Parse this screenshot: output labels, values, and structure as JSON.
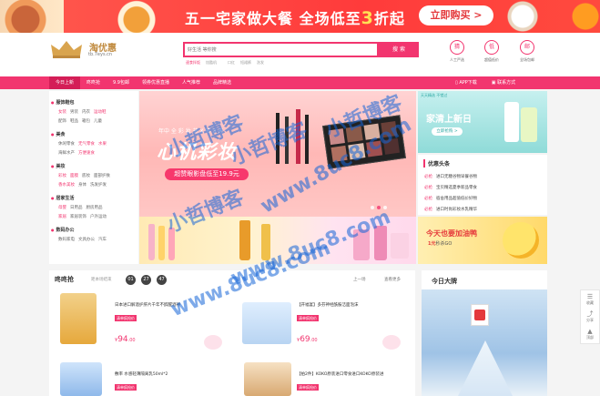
{
  "top_banner": {
    "text_before": "五一宅家做大餐  全场低至",
    "highlight": "3",
    "text_after": "折起",
    "button": "立即购买 >"
  },
  "logo": {
    "title": "淘优惠",
    "domain": "tb.7eys.cn"
  },
  "search": {
    "placeholder": "好生活 等你搜",
    "button": "搜 索",
    "hotwords": [
      "速食拌饭",
      "炫酷机",
      "",
      "口红",
      "短裙裤",
      "洗发"
    ]
  },
  "header_icons": [
    {
      "glyph": "猜",
      "label": "人工严选"
    },
    {
      "glyph": "低",
      "label": "超值低价"
    },
    {
      "glyph": "邮",
      "label": "全场包邮"
    }
  ],
  "nav": {
    "items": [
      "今日上新",
      "咚咚抢",
      "9.9包邮",
      "领券优惠直播",
      "人气推荐",
      "品牌精选"
    ],
    "active_index": 0,
    "right": [
      "APP下载",
      "联系方式"
    ]
  },
  "categories": [
    {
      "title": "服饰鞋包",
      "rows": [
        [
          "女装",
          "男装",
          "内衣",
          "运动鞋"
        ],
        [
          "配饰",
          "鞋品",
          "箱包",
          "儿童"
        ]
      ]
    },
    {
      "title": "美食",
      "rows": [
        [
          "休闲零食",
          "无气零食",
          "水果"
        ],
        [
          "海鲜水产",
          "方便速食"
        ]
      ]
    },
    {
      "title": "美妆",
      "rows": [
        [
          "彩妆",
          "面膜",
          "底妆",
          "面部护肤"
        ],
        [
          "香水美妆",
          "身体",
          "洗发护发"
        ]
      ]
    },
    {
      "title": "居家生活",
      "rows": [
        [
          "母婴",
          "日用品",
          "厨房用品"
        ],
        [
          "家居",
          "家居装饰",
          "户外运动"
        ]
      ]
    },
    {
      "title": "数码办公",
      "rows": [
        [
          "数码家电",
          "文具办公",
          "汽车"
        ]
      ]
    }
  ],
  "main_banner": {
    "subtitle": "年中  全  彩  妆  节  X  节  3  天",
    "title": "心机彩妆",
    "pill": "超赞眼影盘低至19.9元"
  },
  "new_panel": {
    "tag": "天天精选 不错过",
    "title": "家清上新日",
    "pill": "立即抢购 >"
  },
  "toutiao": {
    "title": "优惠头条",
    "items": [
      {
        "tag": "必抢",
        "text": "进口无糖谷物早餐谷物"
      },
      {
        "tag": "必抢",
        "text": "宝贝精选夏季新品零食"
      },
      {
        "tag": "必抢",
        "text": "宿舍用品超值低价好物"
      },
      {
        "tag": "必抢",
        "text": "进口时尚彩妆水乳精华"
      }
    ]
  },
  "ad2": {
    "title": "今天也要加油鸭",
    "sub_pre": "",
    "sub_price": "1元",
    "sub_post": "秒杀GO"
  },
  "grab": {
    "title": "咚咚抢",
    "countdown_label": "距本场结束",
    "countdown": [
      "01",
      "27",
      "47"
    ],
    "prev": "上一场",
    "more": "查看更多",
    "products": [
      {
        "name": "日本进口解酒护肝片千年不醉醒酒神",
        "badge": "清单疯抢价",
        "price": "94",
        "decimal": ".00"
      },
      {
        "name": "【开福宴】多芬神经酰胺洁面泡沫",
        "badge": "清单疯抢价",
        "price": "69",
        "decimal": ".00"
      },
      {
        "name": "敷率 水感轻薄隔离乳50ml*2",
        "badge": "清单疯抢价",
        "price": "",
        "decimal": ""
      },
      {
        "name": "【拍2件】KOKO原装进口零食进口KOKO原装进",
        "badge": "清单疯抢价",
        "price": "",
        "decimal": ""
      }
    ]
  },
  "big_brand": {
    "title": "今日大牌"
  },
  "float_bar": [
    {
      "icon": "☰",
      "label": "收藏"
    },
    {
      "icon": "⤴",
      "label": "分享"
    },
    {
      "icon": "▲",
      "label": "顶部"
    }
  ],
  "watermark": {
    "line1": "小哲博客",
    "line2": "www.8uc8.com"
  }
}
